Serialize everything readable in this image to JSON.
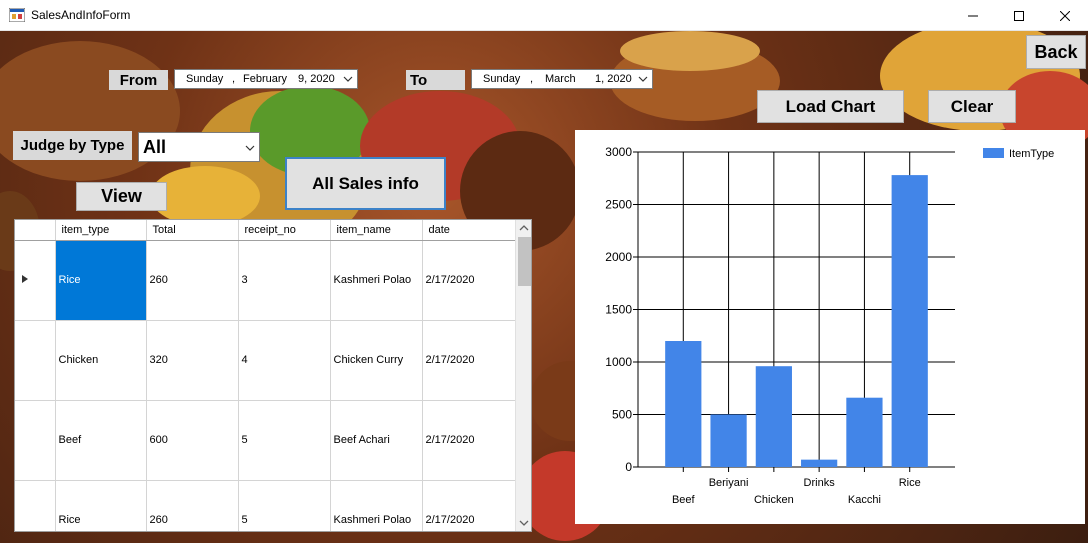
{
  "window": {
    "title": "SalesAndInfoForm"
  },
  "filters": {
    "from_label": "From",
    "to_label": "To",
    "from_date": {
      "day": "Sunday",
      "sep": ",",
      "month": "February",
      "date": "9, 2020"
    },
    "to_date": {
      "day": "Sunday",
      "sep": ",",
      "month": "March",
      "date": "1, 2020"
    },
    "judge_label": "Judge by Type",
    "type_value": "All"
  },
  "buttons": {
    "back": "Back",
    "load_chart": "Load Chart",
    "clear": "Clear",
    "view": "View",
    "all_sales": "All Sales info"
  },
  "table": {
    "columns": [
      "item_type",
      "Total",
      "receipt_no",
      "item_name",
      "date"
    ],
    "rows": [
      [
        "Rice",
        "260",
        "3",
        "Kashmeri Polao",
        "2/17/2020"
      ],
      [
        "Chicken",
        "320",
        "4",
        "Chicken Curry",
        "2/17/2020"
      ],
      [
        "Beef",
        "600",
        "5",
        "Beef Achari",
        "2/17/2020"
      ],
      [
        "Rice",
        "260",
        "5",
        "Kashmeri Polao",
        "2/17/2020"
      ]
    ]
  },
  "colors": {
    "accent": "#0078d7",
    "bar": "#4285e8"
  },
  "chart_data": {
    "type": "bar",
    "categories": [
      "Beef",
      "Beriyani",
      "Chicken",
      "Drinks",
      "Kacchi",
      "Rice"
    ],
    "series": [
      {
        "name": "ItemType",
        "values": [
          1200,
          500,
          960,
          70,
          660,
          2780
        ]
      }
    ],
    "ylim": [
      0,
      3000
    ],
    "yticks": [
      0,
      500,
      1000,
      1500,
      2000,
      2500,
      3000
    ],
    "grid": true,
    "legend": "top-right"
  }
}
